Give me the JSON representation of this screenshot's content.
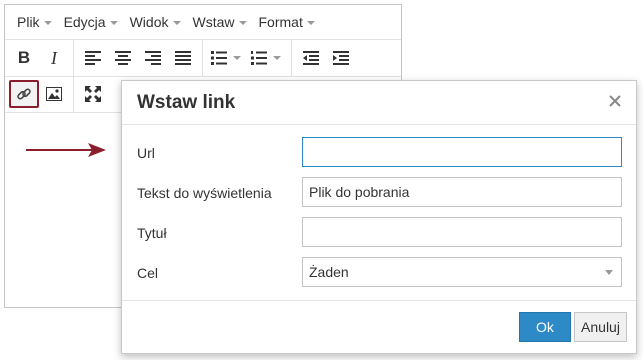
{
  "menubar": {
    "items": [
      {
        "label": "Plik"
      },
      {
        "label": "Edycja"
      },
      {
        "label": "Widok"
      },
      {
        "label": "Wstaw"
      },
      {
        "label": "Format"
      }
    ]
  },
  "toolbar": {
    "bold_label": "B",
    "italic_label": "I",
    "icons": [
      "bold-icon",
      "italic-icon",
      "align-left-icon",
      "align-center-icon",
      "align-right-icon",
      "align-justify-icon",
      "bullet-list-icon",
      "numbered-list-icon",
      "outdent-icon",
      "indent-icon",
      "link-icon",
      "image-icon",
      "fullscreen-icon"
    ]
  },
  "dialog": {
    "title": "Wstaw link",
    "fields": {
      "url": {
        "label": "Url",
        "value": ""
      },
      "text": {
        "label": "Tekst do wyświetlenia",
        "value": "Plik do pobrania"
      },
      "title": {
        "label": "Tytuł",
        "value": ""
      },
      "target": {
        "label": "Cel",
        "value": "Żaden"
      }
    },
    "ok_label": "Ok",
    "cancel_label": "Anuluj"
  },
  "colors": {
    "accent": "#2d8ac7",
    "highlight_border": "#8b1e2d",
    "arrow": "#8b1e2d"
  }
}
